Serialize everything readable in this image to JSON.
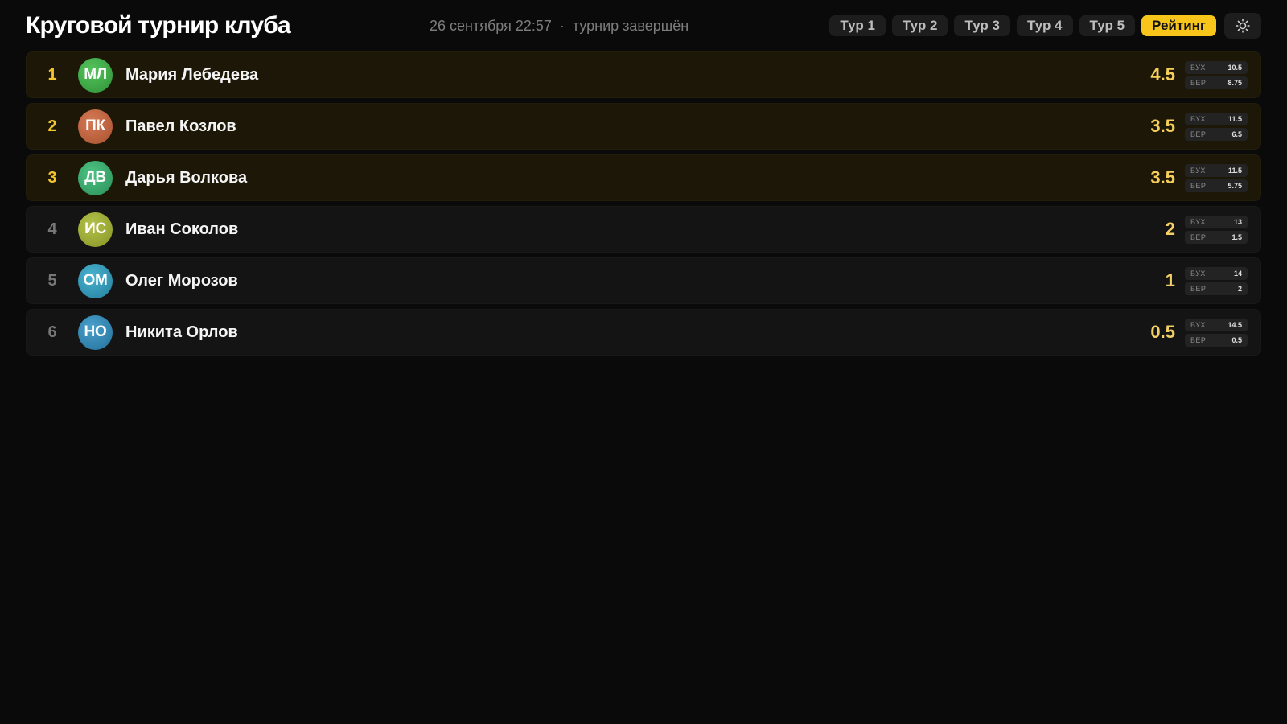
{
  "header": {
    "title": "Круговой турнир клуба",
    "date": "26 сентября 22:57",
    "separator": "·",
    "status": "турнир завершён"
  },
  "nav": {
    "tabs": [
      {
        "label": "Тур 1",
        "active": false
      },
      {
        "label": "Тур 2",
        "active": false
      },
      {
        "label": "Тур 3",
        "active": false
      },
      {
        "label": "Тур 4",
        "active": false
      },
      {
        "label": "Тур 5",
        "active": false
      },
      {
        "label": "Рейтинг",
        "active": true
      }
    ],
    "theme_icon": "sun-icon"
  },
  "tiebreak_labels": {
    "buchholz": "БУХ",
    "berger": "БЕР"
  },
  "colors": {
    "accent": "#f8c51b",
    "podium_bg": "#1c1707",
    "row_bg": "#141414"
  },
  "standings": [
    {
      "rank": "1",
      "initials": "МЛ",
      "name": "Мария Лебедева",
      "score": "4.5",
      "buchholz": "10.5",
      "berger": "8.75",
      "avatar_color": "#3aa843",
      "podium": true
    },
    {
      "rank": "2",
      "initials": "ПК",
      "name": "Павел Козлов",
      "score": "3.5",
      "buchholz": "11.5",
      "berger": "6.5",
      "avatar_color": "#c0613e",
      "podium": true
    },
    {
      "rank": "3",
      "initials": "ДВ",
      "name": "Дарья Волкова",
      "score": "3.5",
      "buchholz": "11.5",
      "berger": "5.75",
      "avatar_color": "#36a86d",
      "podium": true
    },
    {
      "rank": "4",
      "initials": "ИС",
      "name": "Иван Соколов",
      "score": "2",
      "buchholz": "13",
      "berger": "1.5",
      "avatar_color": "#9aa832",
      "podium": false
    },
    {
      "rank": "5",
      "initials": "ОМ",
      "name": "Олег Морозов",
      "score": "1",
      "buchholz": "14",
      "berger": "2",
      "avatar_color": "#2f99b8",
      "podium": false
    },
    {
      "rank": "6",
      "initials": "НО",
      "name": "Никита Орлов",
      "score": "0.5",
      "buchholz": "14.5",
      "berger": "0.5",
      "avatar_color": "#3589b5",
      "podium": false
    }
  ]
}
